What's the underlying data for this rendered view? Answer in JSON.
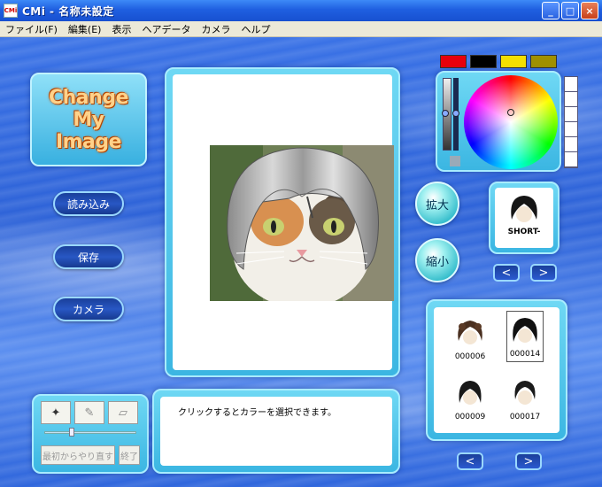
{
  "window": {
    "title": "CMi - 名称未設定",
    "icon_text": "CMi",
    "controls": [
      "_",
      "□",
      "×"
    ]
  },
  "menu": [
    "ファイル(F)",
    "編集(E)",
    "表示",
    "ヘアデータ",
    "カメラ",
    "ヘルプ"
  ],
  "logo": {
    "line1": "Change My",
    "line2": "Image"
  },
  "left_buttons": {
    "load": "読み込み",
    "save": "保存",
    "camera": "カメラ"
  },
  "zoom": {
    "in": "拡大",
    "out": "縮小"
  },
  "palette": {
    "swatches": [
      "#e8000c",
      "#000000",
      "#f4e000",
      "#a09000"
    ]
  },
  "current_hair": {
    "label": "SHORT-"
  },
  "nav": {
    "prev": "<",
    "next": ">"
  },
  "hair_list": [
    {
      "id": "000006"
    },
    {
      "id": "000014",
      "selected": true
    },
    {
      "id": "000009"
    },
    {
      "id": "000017"
    }
  ],
  "tools": {
    "redo_from_start": "最初からやり直す",
    "finish": "終了"
  },
  "message": "クリックするとカラーを選択できます。"
}
